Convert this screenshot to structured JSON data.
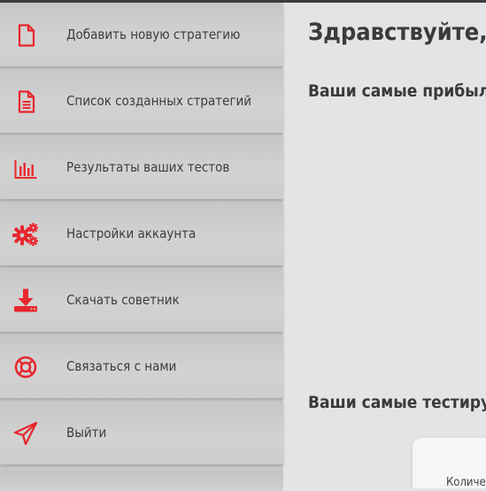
{
  "sidebar": {
    "items": [
      {
        "label": "Добавить новую стратегию",
        "icon": "file-icon"
      },
      {
        "label": "Список созданных стратегий",
        "icon": "document-list-icon"
      },
      {
        "label": "Результаты ваших тестов",
        "icon": "bar-chart-icon"
      },
      {
        "label": "Настройки аккаунта",
        "icon": "gears-icon"
      },
      {
        "label": "Скачать советник",
        "icon": "download-icon"
      },
      {
        "label": "Связаться с нами",
        "icon": "lifebuoy-icon"
      },
      {
        "label": "Выйти",
        "icon": "paper-plane-icon"
      }
    ]
  },
  "main": {
    "greeting": "Здравствуйте, ,",
    "section_profitable": "Ваши самые прибыльные",
    "section_tested": "Ваши самые тестируемые",
    "card_label": "Количество"
  },
  "colors": {
    "accent": "#e8262d",
    "sidebar_bg": "#c9c9c9",
    "main_bg": "#e4e4e4",
    "text": "#3c3c3c",
    "topbar": "#3b3b3f"
  }
}
